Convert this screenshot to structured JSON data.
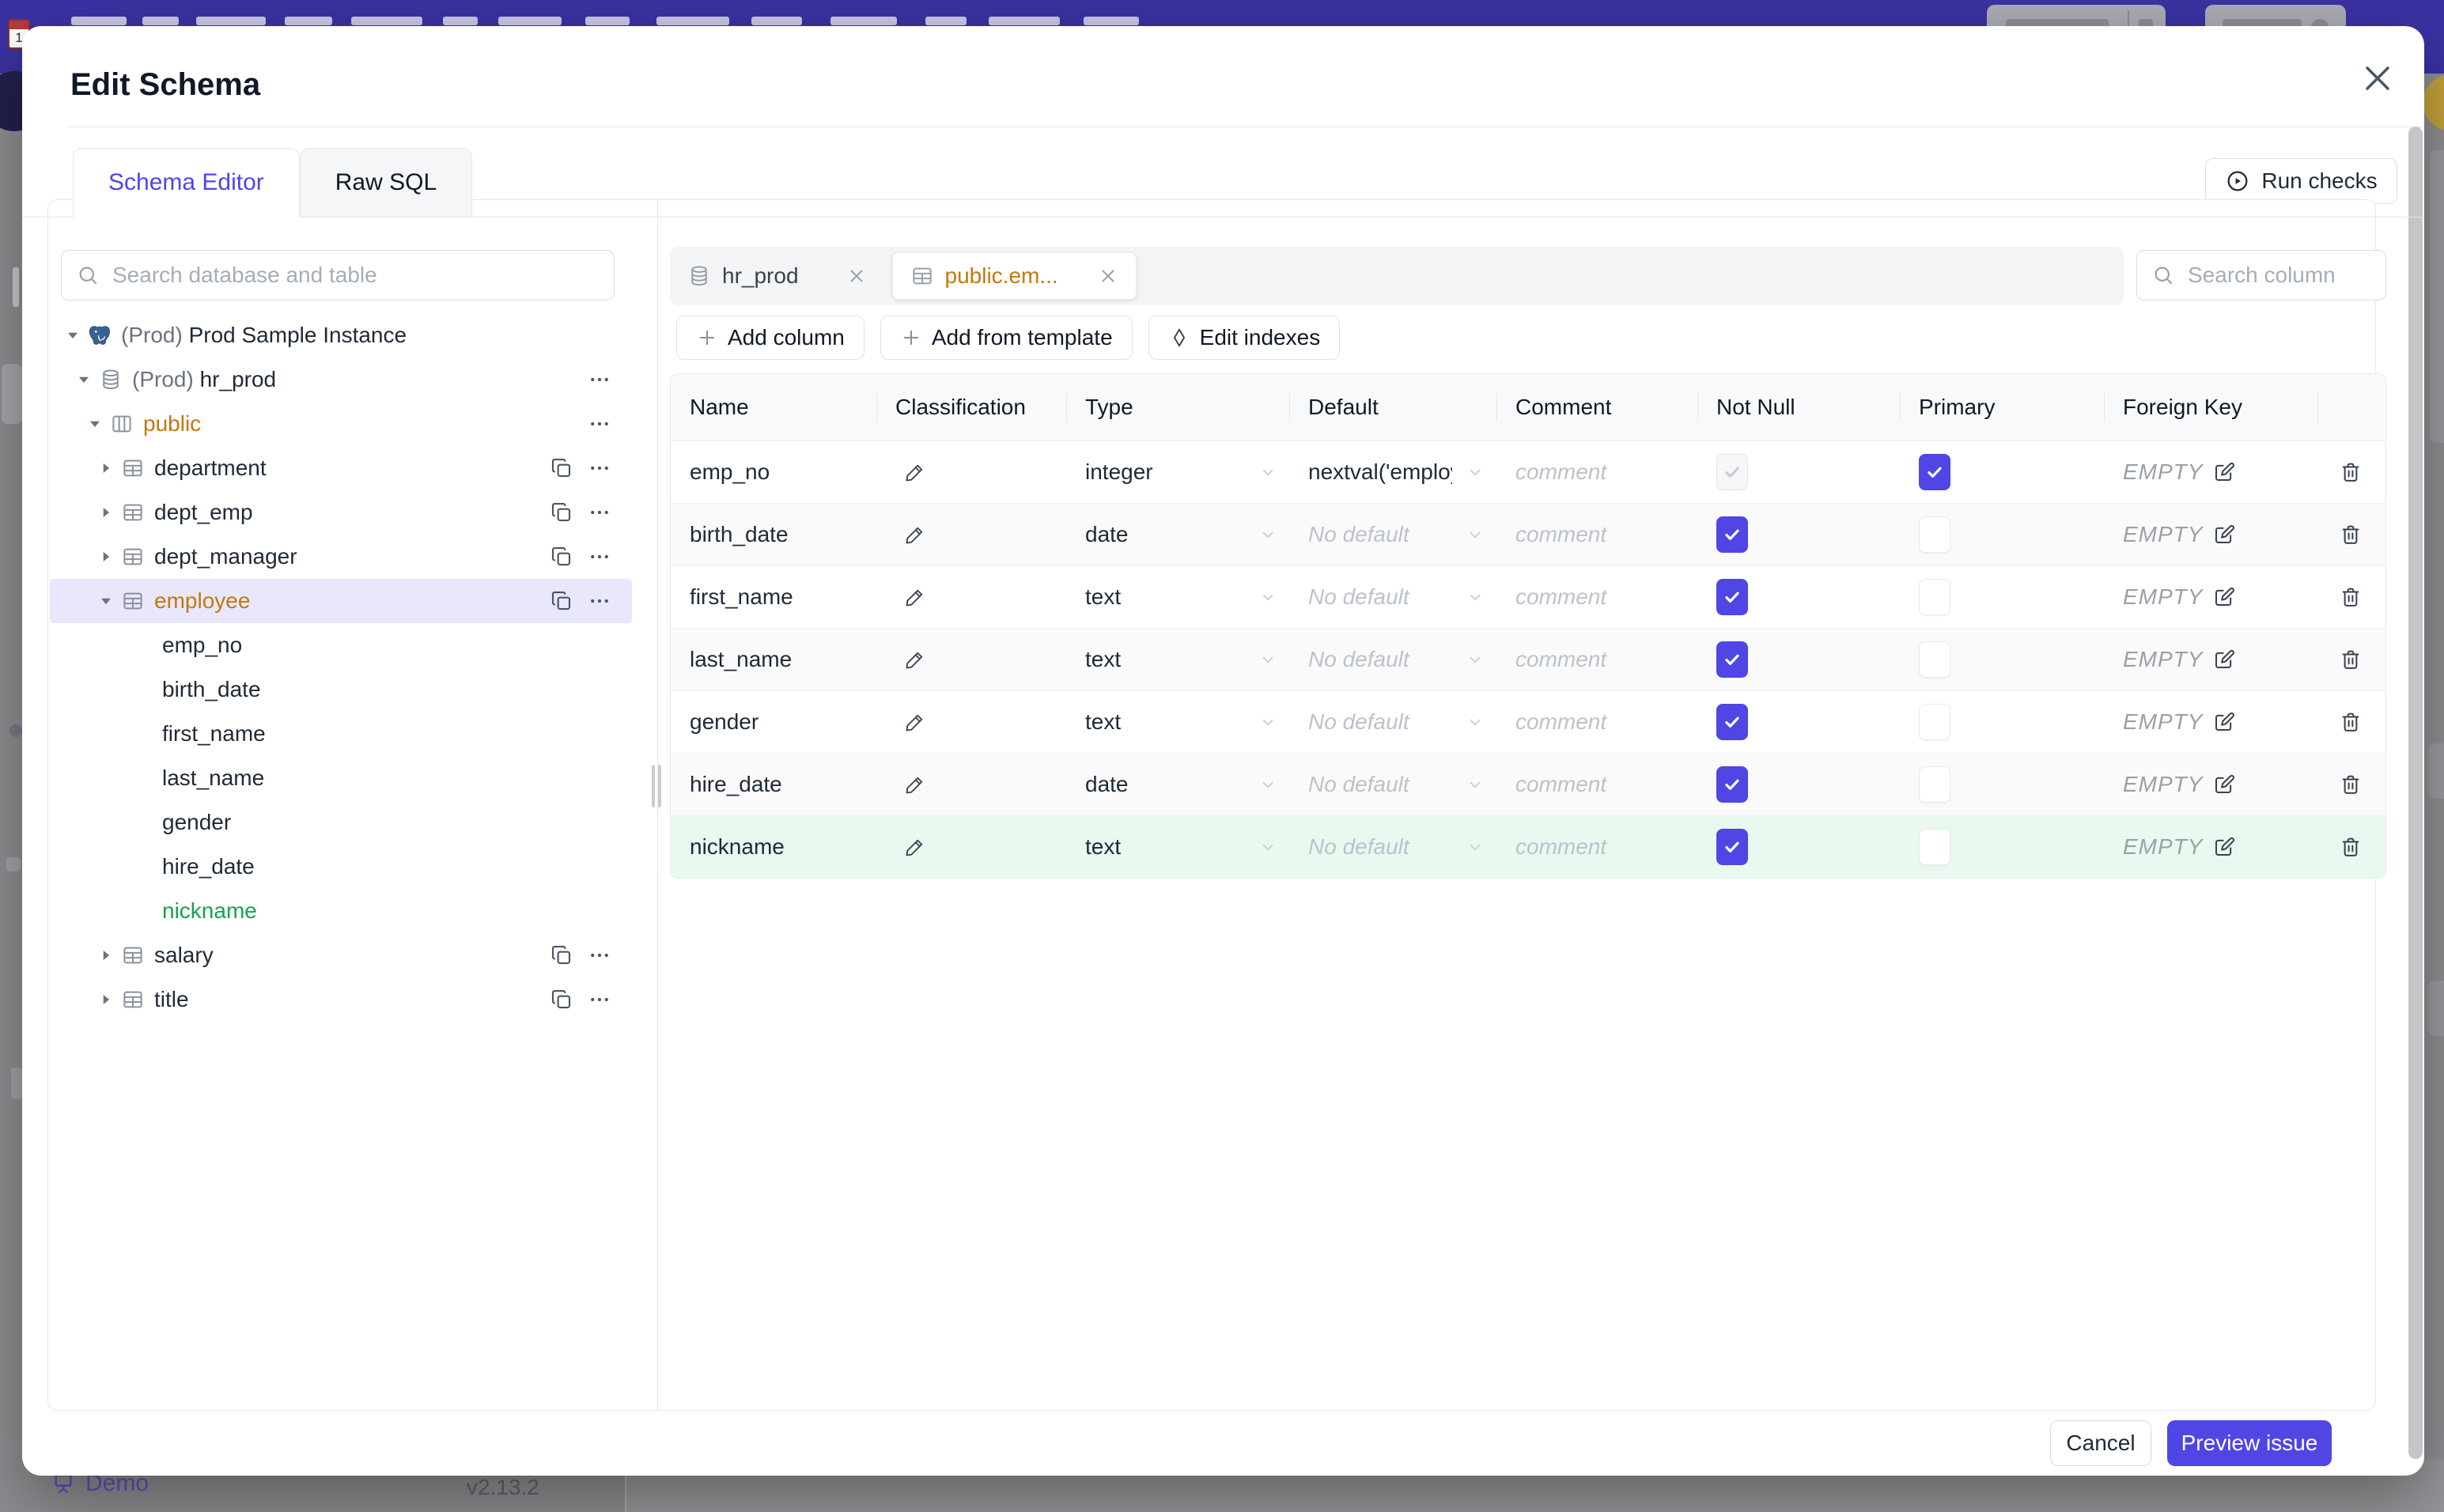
{
  "backdrop": {
    "footer": {
      "brand": "Demo",
      "version": "v2.13.2"
    },
    "topbar_color": "#3a32a2"
  },
  "modal": {
    "title": "Edit Schema",
    "tabs": [
      {
        "label": "Schema Editor",
        "active": true
      },
      {
        "label": "Raw SQL",
        "active": false
      }
    ],
    "run_checks_label": "Run checks",
    "footer": {
      "cancel_label": "Cancel",
      "submit_label": "Preview issue"
    }
  },
  "sidebar": {
    "search_placeholder": "Search database and table",
    "tree": [
      {
        "level": 0,
        "caret": "down",
        "icon": "postgres-icon",
        "prefix": "(Prod) ",
        "label": "Prod Sample Instance",
        "actions": []
      },
      {
        "level": 1,
        "caret": "down",
        "icon": "database-icon",
        "prefix": "(Prod) ",
        "label": "hr_prod",
        "actions": [
          "menu"
        ]
      },
      {
        "level": 2,
        "caret": "down",
        "icon": "schema-icon",
        "label": "public",
        "color": "amber",
        "actions": [
          "menu"
        ]
      },
      {
        "level": 3,
        "caret": "right",
        "icon": "table-icon",
        "label": "department",
        "actions": [
          "copy",
          "menu"
        ]
      },
      {
        "level": 3,
        "caret": "right",
        "icon": "table-icon",
        "label": "dept_emp",
        "actions": [
          "copy",
          "menu"
        ]
      },
      {
        "level": 3,
        "caret": "right",
        "icon": "table-icon",
        "label": "dept_manager",
        "actions": [
          "copy",
          "menu"
        ]
      },
      {
        "level": 3,
        "caret": "down",
        "icon": "table-icon",
        "label": "employee",
        "color": "amber",
        "selected": true,
        "actions": [
          "copy",
          "menu"
        ]
      },
      {
        "level": 4,
        "label": "emp_no"
      },
      {
        "level": 4,
        "label": "birth_date"
      },
      {
        "level": 4,
        "label": "first_name"
      },
      {
        "level": 4,
        "label": "last_name"
      },
      {
        "level": 4,
        "label": "gender"
      },
      {
        "level": 4,
        "label": "hire_date"
      },
      {
        "level": 4,
        "label": "nickname",
        "color": "green"
      },
      {
        "level": 3,
        "caret": "right",
        "icon": "table-icon",
        "label": "salary",
        "actions": [
          "copy",
          "menu"
        ]
      },
      {
        "level": 3,
        "caret": "right",
        "icon": "table-icon",
        "label": "title",
        "actions": [
          "copy",
          "menu"
        ]
      }
    ]
  },
  "editor": {
    "chips": [
      {
        "icon": "database-icon",
        "label": "hr_prod",
        "active": false
      },
      {
        "icon": "table-icon",
        "label": "public.em...",
        "active": true
      }
    ],
    "column_search_placeholder": "Search column",
    "actions": [
      {
        "icon": "plus-icon",
        "label": "Add column"
      },
      {
        "icon": "plus-icon",
        "label": "Add from template"
      },
      {
        "icon": "diamond-icon",
        "label": "Edit indexes"
      }
    ],
    "table": {
      "headers": [
        "Name",
        "Classification",
        "Type",
        "Default",
        "Comment",
        "Not Null",
        "Primary",
        "Foreign Key",
        ""
      ],
      "comment_placeholder": "comment",
      "no_default_placeholder": "No default",
      "empty_label": "EMPTY",
      "rows": [
        {
          "name": "emp_no",
          "type": "integer",
          "default": "nextval('employ",
          "has_default": true,
          "not_null": {
            "checked": true,
            "disabled": true
          },
          "primary": true,
          "highlight": false
        },
        {
          "name": "birth_date",
          "type": "date",
          "default": "",
          "has_default": false,
          "not_null": {
            "checked": true,
            "disabled": false
          },
          "primary": false,
          "highlight": false
        },
        {
          "name": "first_name",
          "type": "text",
          "default": "",
          "has_default": false,
          "not_null": {
            "checked": true,
            "disabled": false
          },
          "primary": false,
          "highlight": false
        },
        {
          "name": "last_name",
          "type": "text",
          "default": "",
          "has_default": false,
          "not_null": {
            "checked": true,
            "disabled": false
          },
          "primary": false,
          "highlight": false
        },
        {
          "name": "gender",
          "type": "text",
          "default": "",
          "has_default": false,
          "not_null": {
            "checked": true,
            "disabled": false
          },
          "primary": false,
          "highlight": false
        },
        {
          "name": "hire_date",
          "type": "date",
          "default": "",
          "has_default": false,
          "not_null": {
            "checked": true,
            "disabled": false
          },
          "primary": false,
          "highlight": false
        },
        {
          "name": "nickname",
          "type": "text",
          "default": "",
          "has_default": false,
          "not_null": {
            "checked": true,
            "disabled": false
          },
          "primary": false,
          "highlight": true
        }
      ]
    }
  },
  "colors": {
    "accent": "#4f46e5",
    "amber": "#c2790c",
    "green": "#17a34a",
    "selected_row_bg": "#e9e7fc",
    "highlight_row_bg": "#e9f9f0",
    "topbar": "#3a32a2"
  }
}
